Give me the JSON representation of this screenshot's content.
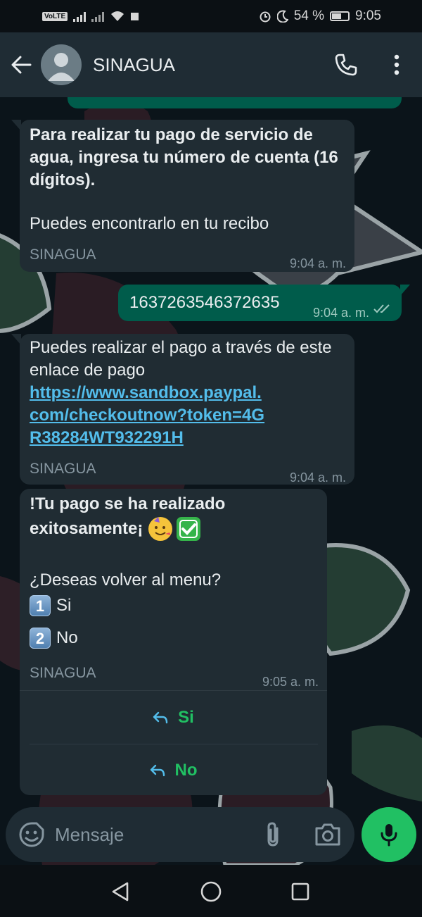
{
  "status_bar": {
    "volte": "VoLTE",
    "battery": "54 %",
    "time": "9:05"
  },
  "header": {
    "contact_name": "SINAGUA"
  },
  "messages": [
    {
      "direction": "incoming",
      "bold_text": "Para realizar tu pago de servicio de agua, ingresa tu número de cuenta (16 dígitos).",
      "text": "Puedes encontrarlo en tu recibo",
      "footer": "SINAGUA",
      "time": "9:04 a. m."
    },
    {
      "direction": "outgoing",
      "text": "1637263546372635",
      "time": "9:04 a. m.",
      "status": "read"
    },
    {
      "direction": "incoming",
      "text": "Puedes realizar el pago a través de este enlace de pago",
      "link": "https://www.sandbox.paypal.com/checkoutnow?token=4GR38284WT932291H",
      "footer": "SINAGUA",
      "time": "9:04 a. m."
    },
    {
      "direction": "incoming",
      "bold_line1": "!Tu pago se ha realizado",
      "bold_line2": "exitosamente¡",
      "question": "¿Deseas volver al menu?",
      "option1_num": "1",
      "option1_label": "Si",
      "option2_num": "2",
      "option2_label": "No",
      "footer": "SINAGUA",
      "time": "9:05 a. m.",
      "quick_replies": [
        "Si",
        "No"
      ]
    }
  ],
  "input": {
    "placeholder": "Mensaje"
  },
  "colors": {
    "accent": "#21c063",
    "incoming_bubble": "#202c33",
    "outgoing_bubble": "#005c4b",
    "link": "#53bdeb"
  },
  "icons": {
    "back": "arrow-left-icon",
    "call": "phone-icon",
    "more": "more-vertical-icon",
    "emoji": "emoji-icon",
    "attach": "paperclip-icon",
    "camera": "camera-icon",
    "mic": "microphone-icon"
  }
}
